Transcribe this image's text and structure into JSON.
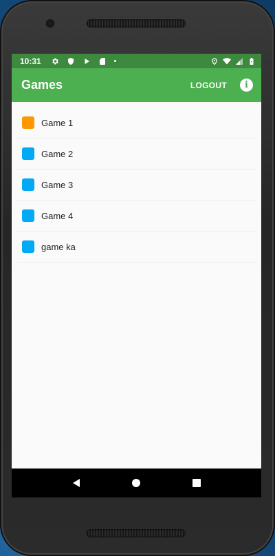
{
  "status_bar": {
    "time": "10:31",
    "left_icons": [
      "gear-icon",
      "shield-icon",
      "play-icon",
      "sd-card-icon",
      "dot-icon"
    ],
    "right_icons": [
      "location-icon",
      "wifi-icon",
      "signal-icon",
      "battery-icon"
    ]
  },
  "app_bar": {
    "title": "Games",
    "logout_label": "LOGOUT",
    "info_icon": "info-icon",
    "color": "#4caf50",
    "status_color": "#3d8a3f"
  },
  "games": [
    {
      "label": "Game 1",
      "color": "#ff9800"
    },
    {
      "label": "Game 2",
      "color": "#03a9f4"
    },
    {
      "label": "Game 3",
      "color": "#03a9f4"
    },
    {
      "label": "Game 4",
      "color": "#03a9f4"
    },
    {
      "label": "game ka",
      "color": "#03a9f4"
    }
  ],
  "nav_bar": {
    "buttons": [
      "back-icon",
      "home-icon",
      "recents-icon"
    ]
  }
}
